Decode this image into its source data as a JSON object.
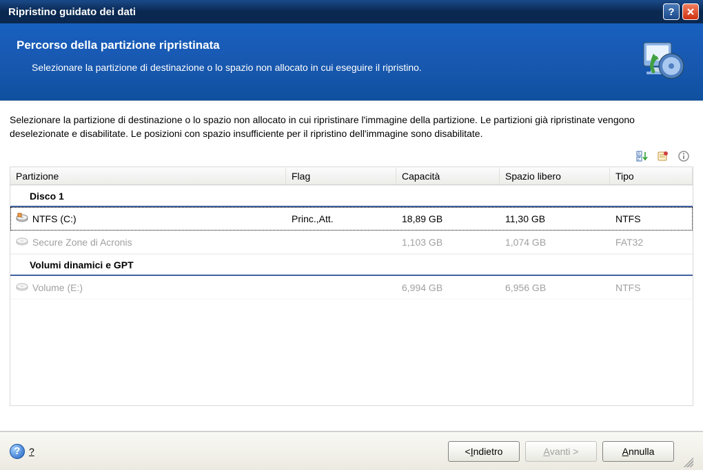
{
  "window": {
    "title": "Ripristino guidato dei dati"
  },
  "banner": {
    "title": "Percorso della partizione ripristinata",
    "subtitle": "Selezionare la partizione di destinazione o lo spazio non allocato in cui eseguire il ripristino."
  },
  "content": {
    "description": "Selezionare la partizione di destinazione o lo spazio non allocato in cui ripristinare l'immagine della partizione. Le partizioni già ripristinate vengono deselezionate e disabilitate. Le posizioni con spazio insufficiente per il ripristino dell'immagine sono disabilitate."
  },
  "columns": {
    "partizione": "Partizione",
    "flag": "Flag",
    "capacita": "Capacità",
    "spazio": "Spazio libero",
    "tipo": "Tipo"
  },
  "groups": {
    "disco1": "Disco 1",
    "volumi": "Volumi dinamici e GPT"
  },
  "rows": {
    "r0": {
      "name": "NTFS (C:)",
      "flag": "Princ.,Att.",
      "cap": "18,89 GB",
      "free": "11,30 GB",
      "tipo": "NTFS"
    },
    "r1": {
      "name": "Secure Zone di Acronis",
      "flag": "",
      "cap": "1,103 GB",
      "free": "1,074 GB",
      "tipo": "FAT32"
    },
    "r2": {
      "name": "Volume (E:)",
      "flag": "",
      "cap": "6,994 GB",
      "free": "6,956 GB",
      "tipo": "NTFS"
    }
  },
  "footer": {
    "help": "?",
    "back_prefix": "< ",
    "back_u": "I",
    "back_rest": "ndietro",
    "next_u": "A",
    "next_rest": "vanti >",
    "cancel_u": "A",
    "cancel_rest": "nnulla"
  }
}
